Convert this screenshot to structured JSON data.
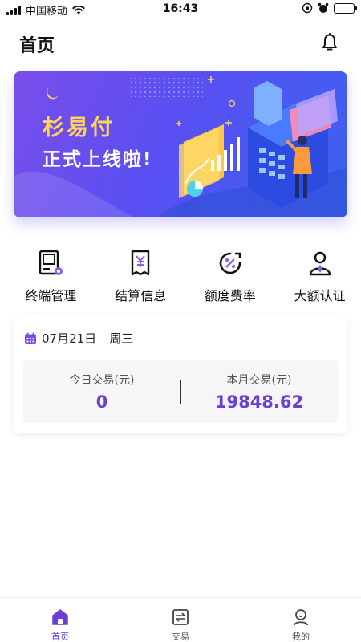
{
  "status_bar": {
    "carrier": "中国移动",
    "time": "16:43"
  },
  "header": {
    "title": "首页",
    "notification_icon": "bell-icon"
  },
  "banner": {
    "title": "杉易付",
    "subtitle": "正式上线啦!",
    "colors": {
      "gradient_start": "#7a4dea",
      "gradient_end": "#3a62f0",
      "title": "#ffd45c"
    }
  },
  "menu": {
    "items": [
      {
        "label": "终端管理",
        "icon": "terminal-icon"
      },
      {
        "label": "结算信息",
        "icon": "receipt-yuan-icon"
      },
      {
        "label": "额度费率",
        "icon": "percent-icon"
      },
      {
        "label": "大额认证",
        "icon": "user-verify-icon"
      }
    ]
  },
  "stats_card": {
    "date": "07月21日",
    "weekday": "周三",
    "today_label": "今日交易(元)",
    "today_value": "0",
    "month_label": "本月交易(元)",
    "month_value": "19848.62"
  },
  "tab_bar": {
    "tabs": [
      {
        "label": "首页",
        "icon": "home-icon",
        "active": true
      },
      {
        "label": "交易",
        "icon": "transaction-icon",
        "active": false
      },
      {
        "label": "我的",
        "icon": "profile-icon",
        "active": false
      }
    ],
    "accent": "#6a3fd8"
  }
}
